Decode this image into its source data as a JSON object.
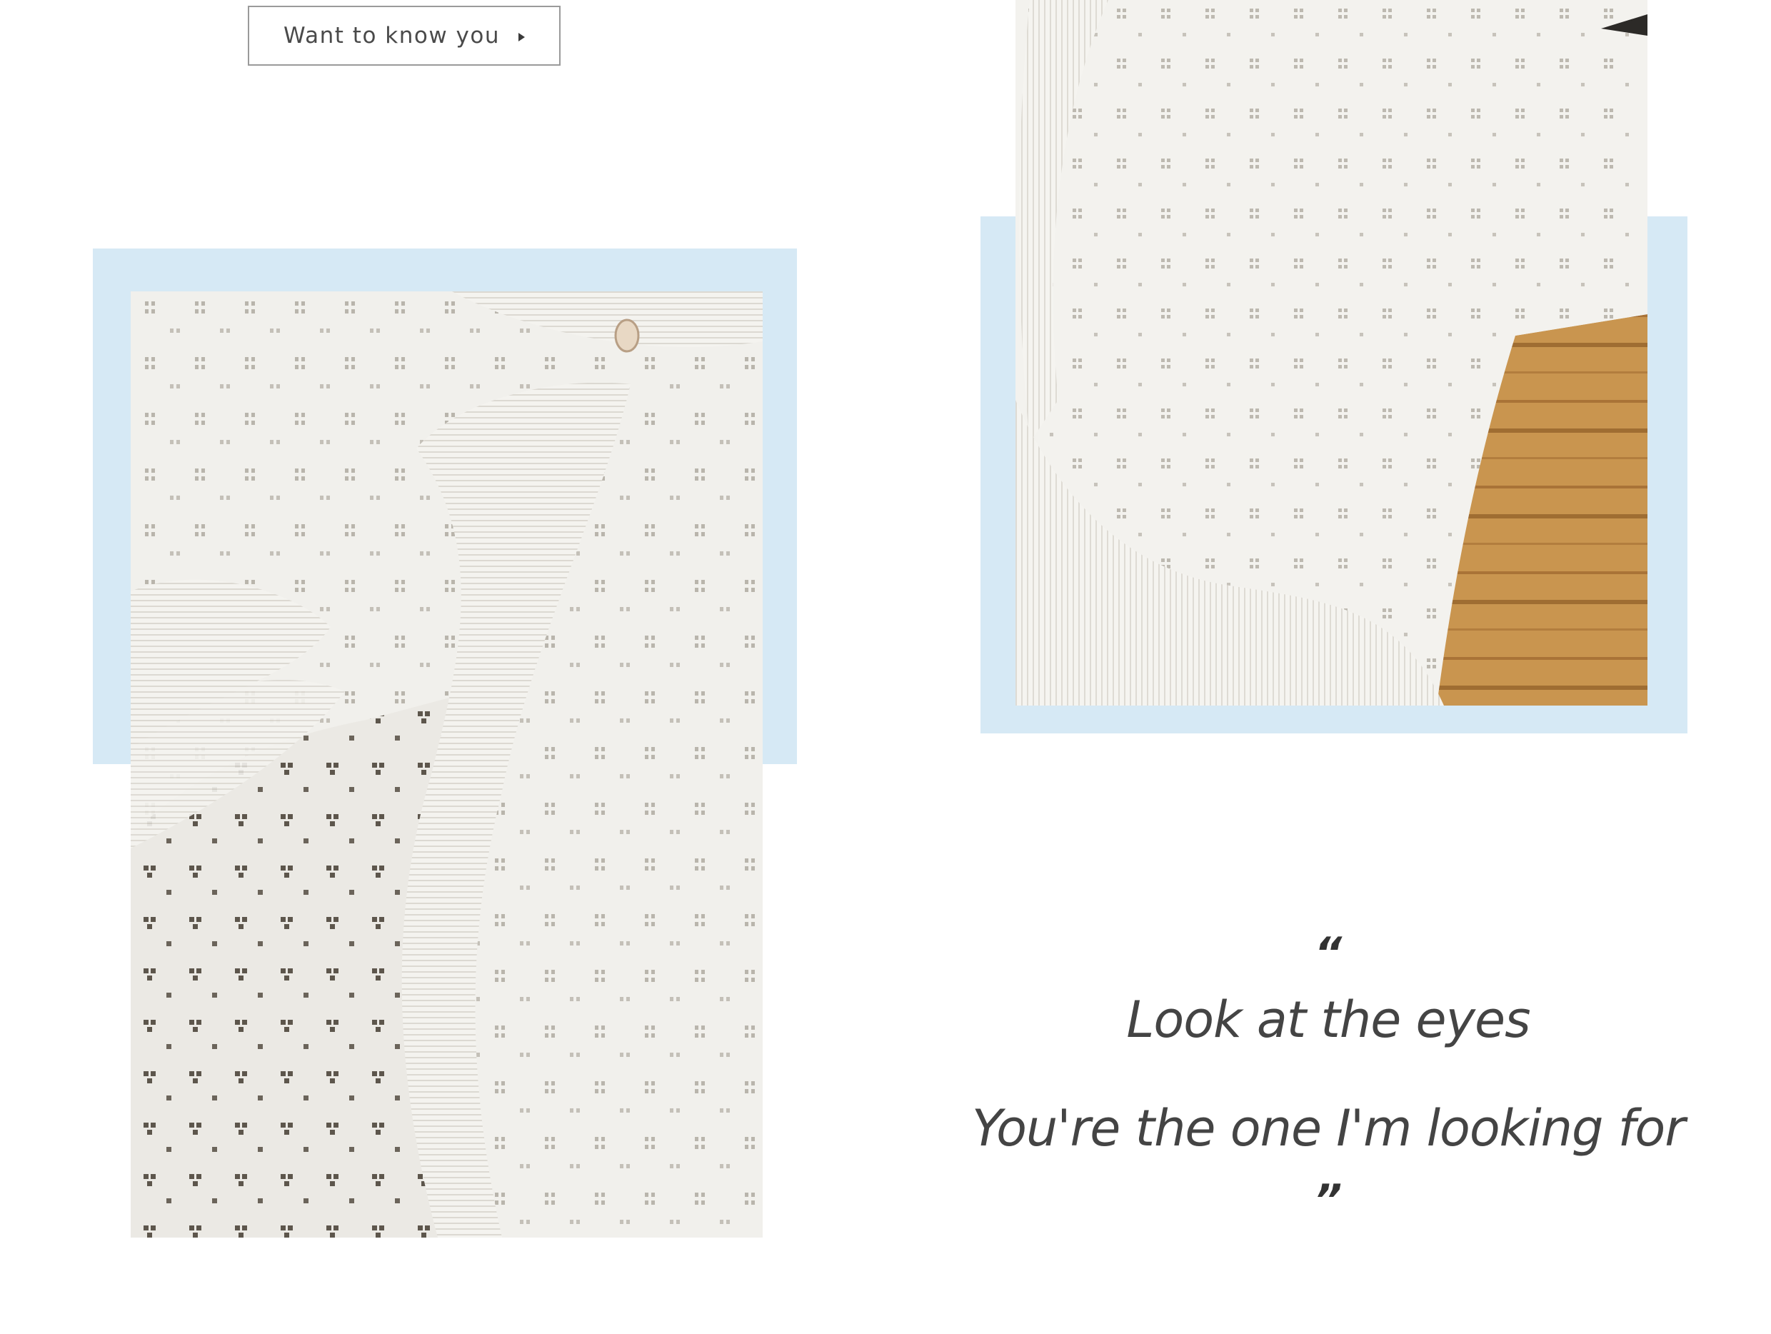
{
  "cta": {
    "label": "Want to know you",
    "arrow_icon": "triangle-right-icon"
  },
  "quote": {
    "open_mark": "“",
    "line1": "Look at the eyes",
    "line2": "You're the one I'm looking for",
    "close_mark": "”"
  },
  "colors": {
    "panel_blue": "#d6e9f5",
    "text": "#444444",
    "border": "#9a9a9a"
  }
}
